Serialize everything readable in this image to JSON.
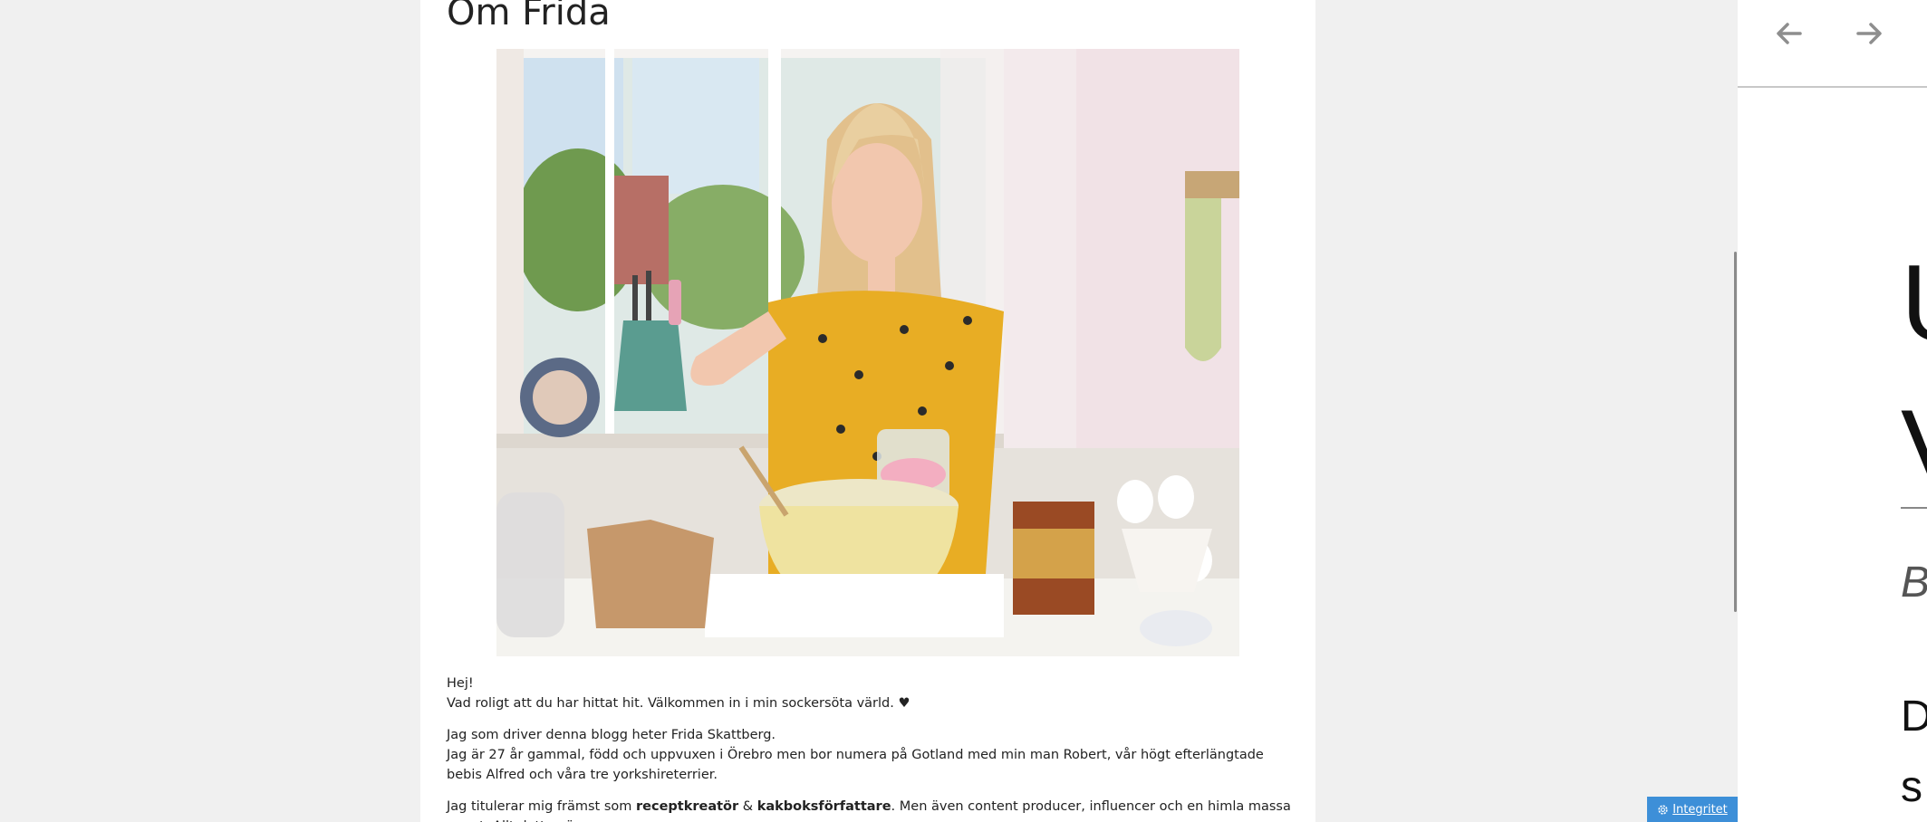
{
  "article": {
    "title": "Om Frida",
    "paragraphs": [
      [
        "Hej!",
        "Vad roligt att du har hittat hit. Välkommen in i min sockersöta värld. ♥"
      ],
      [
        "Jag som driver denna blogg heter Frida Skattberg.",
        "Jag är 27 år gammal, född och uppvuxen i Örebro men bor numera på Gotland med min man Robert, vår högt efterlängtade bebis Alfred och våra tre yorkshireterrier."
      ]
    ],
    "last_paragraph": {
      "text_1": "Jag titulerar mig främst som ",
      "bold_1": "receptkreatör",
      "text_2": " & ",
      "bold_2": "kakboksförfattare",
      "text_3": ". Men även content producer, influencer och en himla massa annat. Allt detta gör"
    }
  },
  "side_panel": {
    "prev_icon": "arrow-left-icon",
    "next_icon": "arrow-right-icon",
    "big_line_1": "U",
    "big_line_2": "V",
    "italic_text": "B",
    "text_1": "D",
    "text_2": "s"
  },
  "privacy": {
    "label": "Integritet",
    "icon": "gear-icon",
    "color": "#3d8fd8"
  },
  "colors": {
    "page_bg": "#f0f0f0",
    "content_bg": "#ffffff",
    "dress": "#e8ad24",
    "bowl": "#efe3a0"
  }
}
